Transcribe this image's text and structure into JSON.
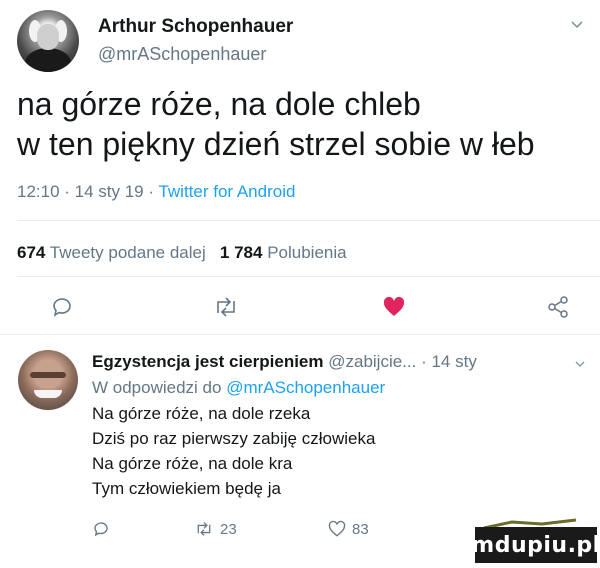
{
  "tweet": {
    "author_name": "Arthur Schopenhauer",
    "author_handle": "@mrASchopenhauer",
    "text_lines": [
      "na górze róże, na dole chleb",
      "w ten piękny dzień strzel sobie w łeb"
    ],
    "meta_time": "12:10 · 14 sty 19 · ",
    "meta_source": "Twitter for Android",
    "retweets_count": "674",
    "retweets_label": "Tweety podane dalej",
    "likes_count": "1 784",
    "likes_label": "Polubienia",
    "colors": {
      "link": "#1da1f2",
      "like": "#e0245e",
      "muted": "#657786"
    }
  },
  "actions": {
    "reply_icon": "comment-icon",
    "retweet_icon": "retweet-icon",
    "like_icon": "heart-filled-icon",
    "share_icon": "share-icon"
  },
  "reply": {
    "author_name": "Egzystencja jest cierpieniem",
    "author_handle": "@zabijcie...",
    "time": "· 14 sty",
    "in_reply_to_prefix": "W odpowiedzi do ",
    "in_reply_to_handle": "@mrASchopenhauer",
    "text_lines": [
      "Na górze róże, na dole rzeka",
      "Dziś po raz pierwszy zabiję człowieka",
      "Na górze róże, na dole kra",
      "Tym człowiekiem będę ja"
    ],
    "retweets": "23",
    "likes": "83"
  },
  "watermark": {
    "text": "mdupiu.pl"
  }
}
